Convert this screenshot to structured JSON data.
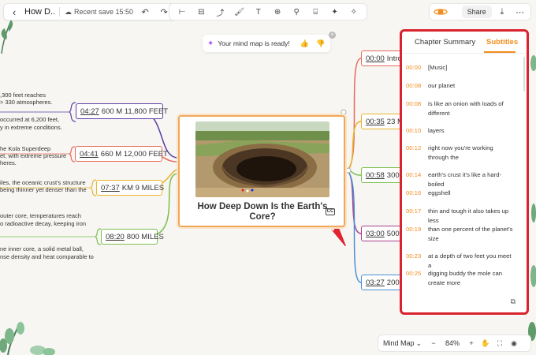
{
  "header": {
    "doc_title": "How D...",
    "save_status": "Recent save 15:50",
    "share_label": "Share"
  },
  "toolbar": {
    "tools": [
      "insert-child-icon",
      "insert-sibling-icon",
      "relationship-icon",
      "brush-icon",
      "text-icon",
      "add-node-icon",
      "branch-icon",
      "summary-icon",
      "ai-sparkle-icon",
      "magic-wand-icon"
    ]
  },
  "notice": {
    "text": "Your mind map is ready!",
    "close": "×"
  },
  "map": {
    "center_title": "How Deep Down Is the Earth's Core?",
    "cc_label": "CC",
    "left_nodes": [
      {
        "time": "04:27",
        "text": "600 M 11,800 FEET"
      },
      {
        "time": "04:41",
        "text": "660 M 12,000 FEET"
      },
      {
        "time": "07:37",
        "text": "KM 9 MILES"
      },
      {
        "time": "08:20",
        "text": "800 MILES"
      }
    ],
    "left_texts": [
      ",300 feet reaches",
      "> 330 atmospheres.",
      "occurred at 6,200 feet,",
      "y in extreme conditions.",
      "he Kola Superdeep",
      "et, with extreme pressure",
      "heres.",
      "iles, the oceanic crust's structure",
      "being thinner yet denser than the",
      "outer core, temperatures reach",
      "o radioactive decay, keeping iron",
      "ne inner core, a solid metal ball,",
      "nse density and heat comparable to"
    ],
    "right_nodes": [
      {
        "time": "00:00",
        "text": "Intro"
      },
      {
        "time": "00:35",
        "text": "23 M"
      },
      {
        "time": "00:58",
        "text": "300"
      },
      {
        "time": "03:00",
        "text": "500"
      },
      {
        "time": "03:27",
        "text": "200"
      }
    ]
  },
  "panel": {
    "tab_summary": "Chapter Summary",
    "tab_subtitles": "Subtitles",
    "subtitles": [
      {
        "time": "00:00",
        "text": "[Music]"
      },
      {
        "time": "00:08",
        "text": "our planet"
      },
      {
        "time": "00:08",
        "text": "is like an onion with loads of different"
      },
      {
        "time": "00:10",
        "text": "layers"
      },
      {
        "time": "00:12",
        "text": "right now you're working through the"
      },
      {
        "time": "00:14",
        "text": "earth's crust it's like a hard-boiled"
      },
      {
        "time": "00:16",
        "text": "eggshell"
      },
      {
        "time": "00:17",
        "text": "thin and tough it also takes up less"
      },
      {
        "time": "00:19",
        "text": "than one percent of the planet's size"
      },
      {
        "time": "00:23",
        "text": "at a depth of two feet you meet a"
      },
      {
        "time": "00:25",
        "text": "digging buddy the mole can create more"
      }
    ]
  },
  "bottombar": {
    "mode_label": "Mind Map",
    "zoom": "84%"
  },
  "colors": {
    "accent": "#f28c1c",
    "panel_border": "#d9232e",
    "purple": "#5b3fa3",
    "red": "#e86a5a",
    "yellow": "#e7b32a",
    "green": "#7bbf4d",
    "blue": "#4a8fd6",
    "magenta": "#a8418a"
  }
}
